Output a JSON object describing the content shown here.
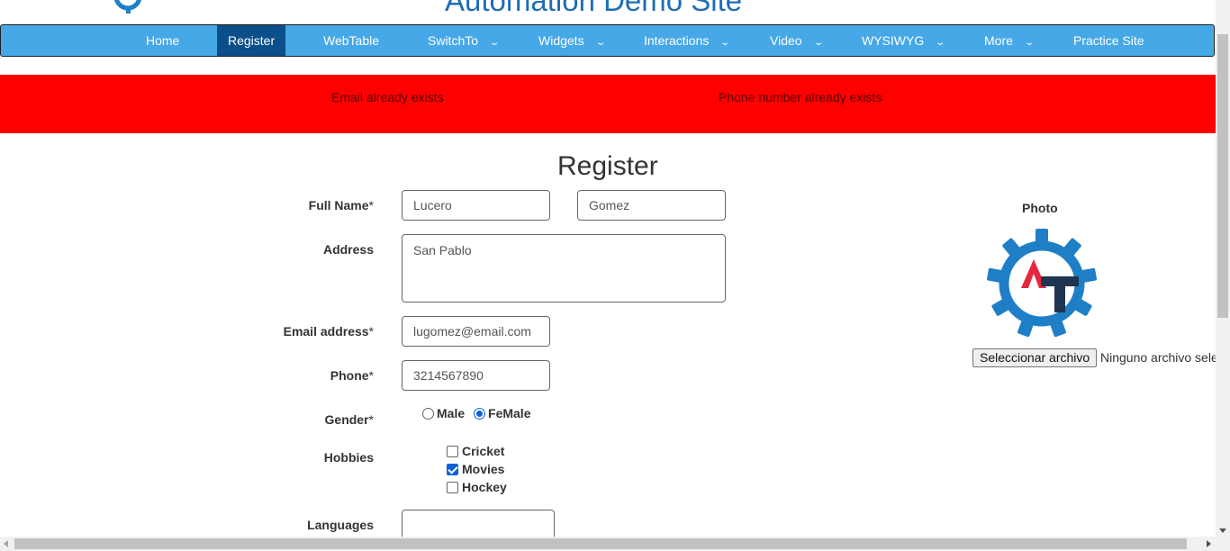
{
  "header": {
    "site_title": "Automation Demo Site"
  },
  "nav": {
    "items": [
      {
        "label": "Home",
        "dropdown": false,
        "active": false
      },
      {
        "label": "Register",
        "dropdown": false,
        "active": true
      },
      {
        "label": "WebTable",
        "dropdown": false,
        "active": false
      },
      {
        "label": "SwitchTo",
        "dropdown": true,
        "active": false
      },
      {
        "label": "Widgets",
        "dropdown": true,
        "active": false
      },
      {
        "label": "Interactions",
        "dropdown": true,
        "active": false
      },
      {
        "label": "Video",
        "dropdown": true,
        "active": false
      },
      {
        "label": "WYSIWYG",
        "dropdown": true,
        "active": false
      },
      {
        "label": "More",
        "dropdown": true,
        "active": false
      },
      {
        "label": "Practice Site",
        "dropdown": false,
        "active": false
      }
    ]
  },
  "errors": {
    "email": "Email already exists",
    "phone": "Phone number already exists"
  },
  "form": {
    "title": "Register",
    "labels": {
      "full_name": "Full Name",
      "address": "Address",
      "email": "Email address",
      "phone": "Phone",
      "gender": "Gender",
      "hobbies": "Hobbies",
      "languages": "Languages",
      "required_mark": "*"
    },
    "first_name": "Lucero",
    "last_name": "Gomez",
    "address": "San Pablo",
    "email": "lugomez@email.com",
    "phone": "3214567890",
    "gender": {
      "male": "Male",
      "female": "FeMale",
      "selected": "FeMale"
    },
    "hobbies": [
      {
        "label": "Cricket",
        "checked": false
      },
      {
        "label": "Movies",
        "checked": true
      },
      {
        "label": "Hockey",
        "checked": false
      }
    ],
    "languages": ""
  },
  "photo": {
    "label": "Photo",
    "choose_button": "Seleccionar archivo",
    "file_status": "Ninguno archivo seleccionado"
  },
  "colors": {
    "navbar": "#46a8e6",
    "nav_active": "#0b4f8a",
    "error_banner": "#ff0000",
    "title_blue": "#1f6db5"
  }
}
